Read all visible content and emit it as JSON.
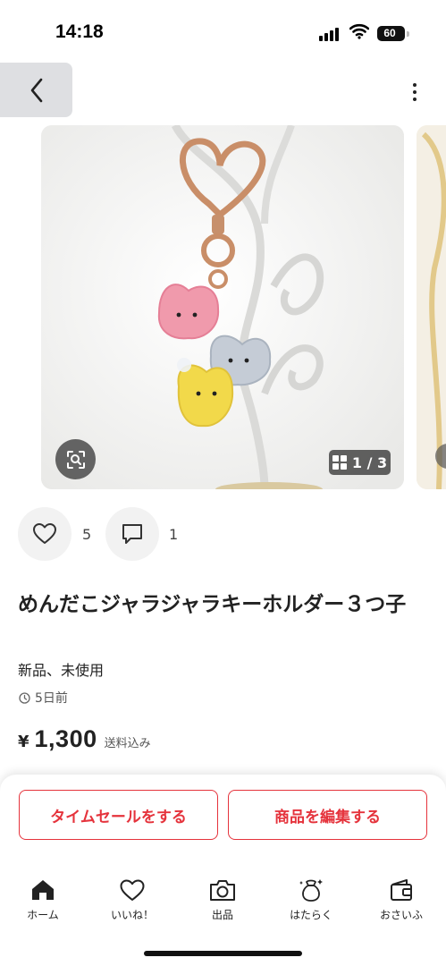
{
  "status_bar": {
    "time": "14:18",
    "battery": "60"
  },
  "header": {
    "back_icon": "chevron-left-icon",
    "more_icon": "more-vertical-icon"
  },
  "gallery": {
    "page_indicator": "1 / 3",
    "current_page": 1,
    "total_pages": 3,
    "zoom_icon": "scan-zoom-icon",
    "grid_icon": "grid-icon"
  },
  "actions": {
    "like_icon": "heart-icon",
    "like_count": "5",
    "comment_icon": "comment-icon",
    "comment_count": "1"
  },
  "product": {
    "title": "めんだこジャラジャラキーホルダー３つ子",
    "condition": "新品、未使用",
    "posted": "5日前",
    "currency": "¥",
    "price": "1,300",
    "shipping_note": "送料込み"
  },
  "buttons": {
    "time_sale": "タイムセールをする",
    "edit_item": "商品を編集する"
  },
  "tabs": [
    {
      "label": "ホーム",
      "icon": "home-icon",
      "active": true
    },
    {
      "label": "いいね！",
      "icon": "heart-icon",
      "active": false
    },
    {
      "label": "出品",
      "icon": "camera-icon",
      "active": false
    },
    {
      "label": "はたらく",
      "icon": "money-bag-icon",
      "active": false
    },
    {
      "label": "おさいふ",
      "icon": "wallet-icon",
      "active": false
    }
  ],
  "colors": {
    "accent": "#e5333c",
    "text": "#222222",
    "surface": "#f2f2f2"
  }
}
